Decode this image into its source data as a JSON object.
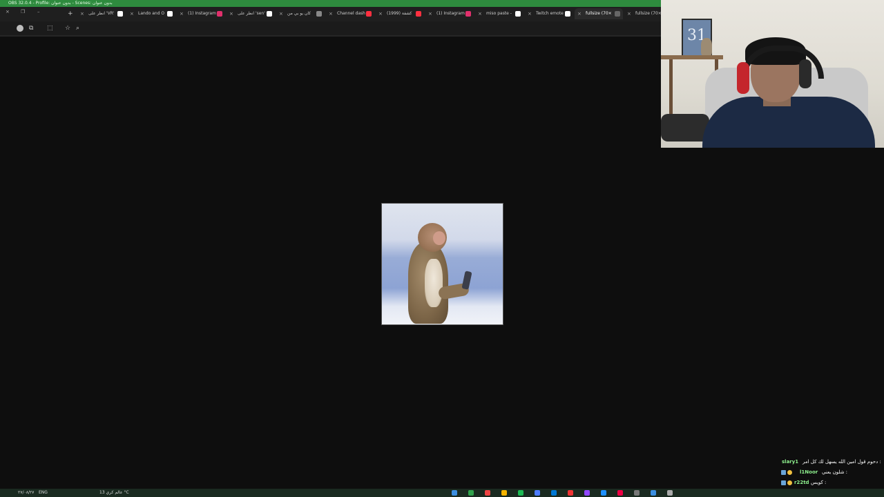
{
  "obs": {
    "title": "OBS 32.0.4 - Profile: بدون عنوان - Scenes: بدون عنوان"
  },
  "browser": {
    "tabs": [
      {
        "label": "انظر على 'VR'",
        "favicon_color": "#ffffff"
      },
      {
        "label": "Lando and O",
        "favicon_color": "#ffffff"
      },
      {
        "label": "(1) Instagram",
        "favicon_color": "#e1306c"
      },
      {
        "label": "انظر على 'sen'",
        "favicon_color": "#ffffff"
      },
      {
        "label": "كان يو بي من",
        "favicon_color": "#888888"
      },
      {
        "label": "Channel dash",
        "favicon_color": "#ff3040"
      },
      {
        "label": "(1999) كشفة",
        "favicon_color": "#ff3040"
      },
      {
        "label": "(1) Instagram",
        "favicon_color": "#e1306c"
      },
      {
        "label": "miso paste -",
        "favicon_color": "#ffffff"
      },
      {
        "label": "Twitch emote",
        "favicon_color": "#ffffff"
      },
      {
        "label": "fullsize (70×",
        "favicon_color": "#666666",
        "active": true
      },
      {
        "label": "fullsize (70×",
        "favicon_color": "#666666"
      }
    ],
    "new_tab_symbol": "+",
    "close_symbol": "×",
    "toolbar": {
      "reload_symbol": "⟳",
      "extensions_symbol": "⧉",
      "bookmark_symbol": "☆",
      "zoom_symbol": "⌕"
    }
  },
  "viewer": {
    "image_alt": "monkey emote"
  },
  "chat": {
    "messages": [
      {
        "user": "slary1",
        "text": "دحوم قول امين الله يسهل لك كل امر :"
      },
      {
        "user": "l1Noor",
        "text": "شلون يعني :"
      },
      {
        "user": "r22td",
        "text": "كويس :"
      }
    ]
  },
  "webcam": {
    "poster_text": "31"
  },
  "taskbar": {
    "date": "٢٧/٠٨/٢٧",
    "lang": "ENG",
    "weather": "عالم كري 13 °C",
    "app_colors": [
      "#3b8ee0",
      "#31a24c",
      "#e44",
      "#f5b400",
      "#1db954",
      "#4d7cff",
      "#0078d4",
      "#e33",
      "#9147ff",
      "#1e90ff",
      "#e04",
      "#777",
      "#3b8ee0",
      "#aaa"
    ]
  }
}
